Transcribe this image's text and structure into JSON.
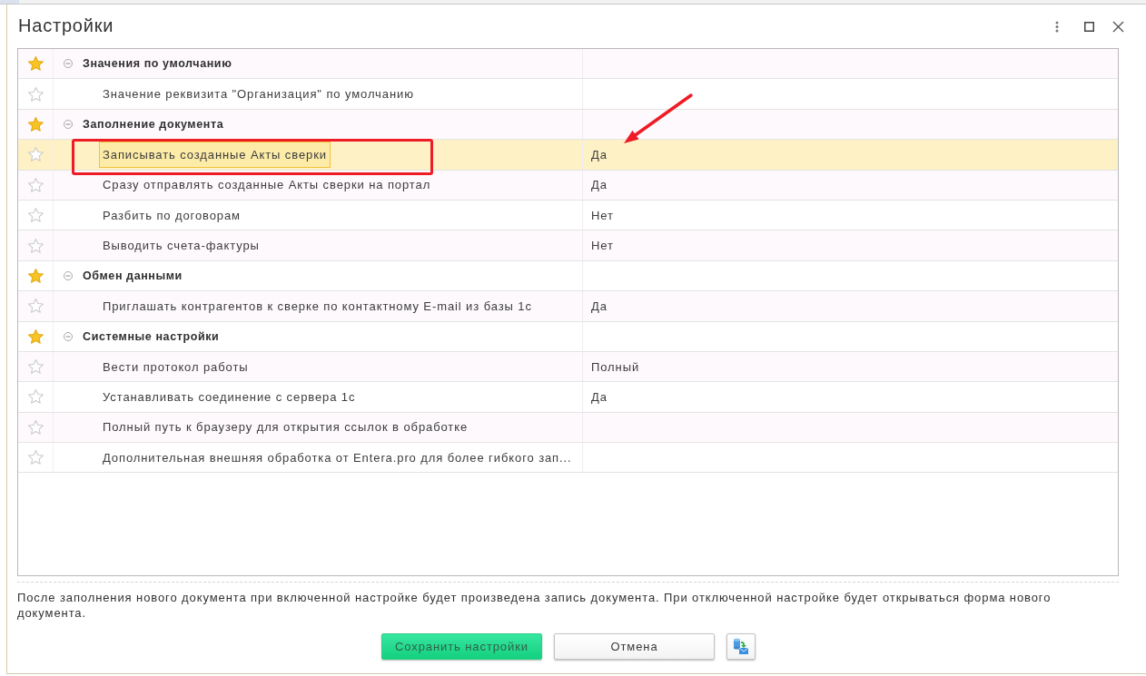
{
  "window": {
    "title": "Настройки"
  },
  "settings": {
    "groups": [
      {
        "title": "Значения по умолчанию",
        "starred": true,
        "expanded": true,
        "selected": false,
        "items": [
          {
            "name": "Значение реквизита \"Организация\" по умолчанию",
            "starred": false,
            "selected": false
          }
        ]
      },
      {
        "title": "Заполнение документа",
        "starred": true,
        "expanded": true,
        "selected": false,
        "items": [
          {
            "name": "Записывать созданные Акты сверки",
            "value": "Да",
            "starred": false,
            "selected": true
          },
          {
            "name": "Сразу отправлять созданные Акты сверки на портал",
            "value": "Да",
            "starred": false,
            "selected": false
          },
          {
            "name": "Разбить по договорам",
            "value": "Нет",
            "starred": false,
            "selected": false
          },
          {
            "name": "Выводить счета-фактуры",
            "value": "Нет",
            "starred": false,
            "selected": false
          }
        ]
      },
      {
        "title": "Обмен данными",
        "starred": true,
        "expanded": true,
        "selected": false,
        "items": [
          {
            "name": "Приглашать контрагентов к сверке по контактному E-mail из базы 1с",
            "value": "Да",
            "starred": false,
            "selected": false
          }
        ]
      },
      {
        "title": "Системные настройки",
        "starred": true,
        "expanded": true,
        "selected": false,
        "items": [
          {
            "name": "Вести протокол работы",
            "value": "Полный",
            "starred": false,
            "selected": false
          },
          {
            "name": "Устанавливать соединение с сервера 1с",
            "value": "Да",
            "starred": false,
            "selected": false
          },
          {
            "name": "Полный путь к браузеру для открытия ссылок в обработке",
            "starred": false,
            "selected": false
          },
          {
            "name": "Дополнительная внешняя обработка от Entera.pro для более гибкого зап...",
            "starred": false,
            "selected": false
          }
        ]
      }
    ]
  },
  "hint": "После заполнения нового документа при включенной настройке будет произведена запись документа. При отключенной настройке будет открываться форма нового документа.",
  "buttons": [
    {
      "label": "Сохранить настройки",
      "kind": "primary"
    },
    {
      "label": "Отмена",
      "kind": "default"
    },
    {
      "kind": "icon"
    }
  ]
}
